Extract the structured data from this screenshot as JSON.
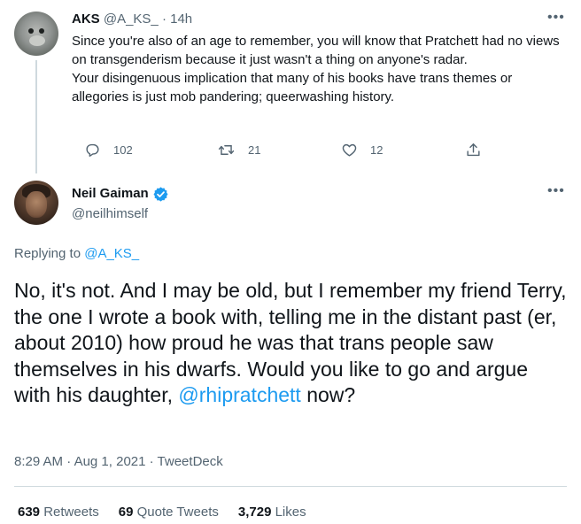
{
  "reply_tweet": {
    "author_name": "AKS",
    "author_handle": "@A_KS_",
    "separator": "·",
    "time_ago": "14h",
    "text_paragraph_1": "Since you're also of an age to remember, you will know that Pratchett had no views on transgenderism because it just wasn't a thing on anyone's radar.",
    "text_paragraph_2": "Your disingenuous implication that many of his books have trans themes or allegories is just mob pandering; queerwashing history.",
    "reply_count": "102",
    "retweet_count": "21",
    "like_count": "12",
    "icons": {
      "more": "more-horizontal-icon",
      "reply": "reply-icon",
      "retweet": "retweet-icon",
      "like": "heart-icon",
      "share": "share-icon"
    }
  },
  "main_tweet": {
    "author_name": "Neil Gaiman",
    "author_handle": "@neilhimself",
    "verified_icon": "verified-badge-icon",
    "verified_color": "#1d9bf0",
    "replying_prefix": "Replying to",
    "replying_to": "@A_KS_",
    "text_main": "No, it's not. And I may be old, but I remember my friend Terry, the one I wrote a book with, telling me in the distant past (er, about 2010) how proud he was that trans people saw themselves in his dwarfs. Would you like to go and argue with his daughter,",
    "mention": "@rhipratchett",
    "text_end": "now?",
    "time": "8:29 AM",
    "date": "Aug 1, 2021",
    "source": "TweetDeck",
    "separator": "·",
    "stats": {
      "retweets_count": "639",
      "retweets_label": "Retweets",
      "quote_count": "69",
      "quote_label": "Quote Tweets",
      "likes_count": "3,729",
      "likes_label": "Likes"
    }
  },
  "colors": {
    "text_primary": "#0f1419",
    "text_secondary": "#536471",
    "link": "#1d9bf0",
    "divider": "#cfd9de"
  }
}
